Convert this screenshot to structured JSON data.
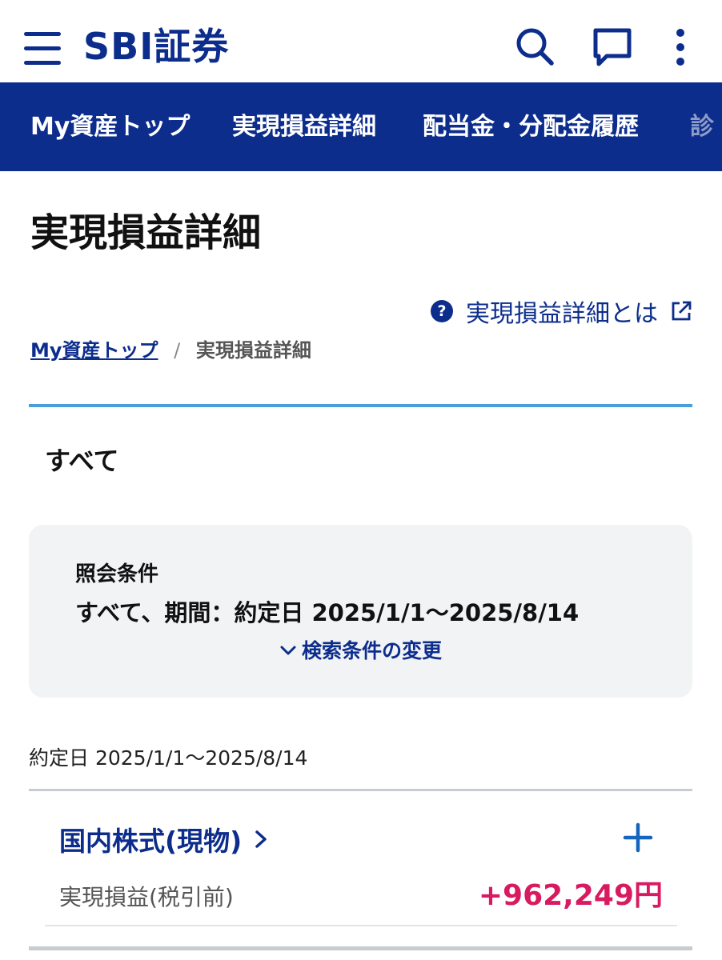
{
  "header": {
    "logo_text": "SBI証券",
    "icons": [
      "menu-icon",
      "search-icon",
      "chat-icon",
      "more-vertical-icon"
    ]
  },
  "nav": {
    "items": [
      {
        "label": "My資産トップ"
      },
      {
        "label": "実現損益詳細"
      },
      {
        "label": "配当金・分配金履歴"
      },
      {
        "label": "診"
      }
    ]
  },
  "page": {
    "title": "実現損益詳細",
    "help_link": "実現損益詳細とは"
  },
  "breadcrumb": {
    "home": "My資産トップ",
    "separator": "/",
    "current": "実現損益詳細"
  },
  "section_label": "すべて",
  "conditions": {
    "title": "照会条件",
    "value": "すべて、期間：約定日 2025/1/1〜2025/8/14",
    "change_label": "検索条件の変更"
  },
  "period": "約定日 2025/1/1〜2025/8/14",
  "category": {
    "name": "国内株式(現物)",
    "pl_label": "実現損益(税引前)",
    "pl_value": "+962,249円"
  },
  "colors": {
    "brand": "#0c2d8c",
    "accent_line": "#4a9fdb",
    "profit": "#d81b60"
  }
}
